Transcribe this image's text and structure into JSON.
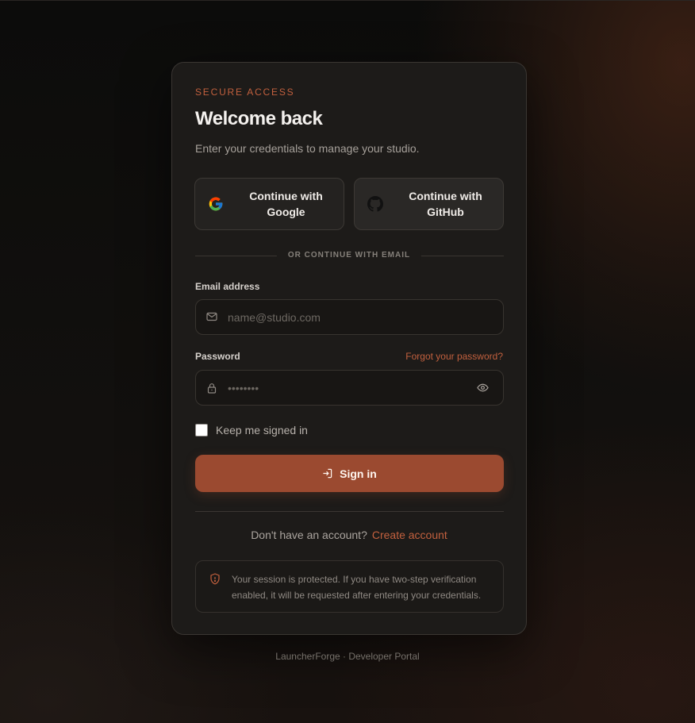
{
  "card": {
    "eyebrow": "SECURE ACCESS",
    "title": "Welcome back",
    "subtitle": "Enter your credentials to manage your studio."
  },
  "oauth": {
    "google_label": "Continue with Google",
    "github_label": "Continue with GitHub"
  },
  "divider_label": "OR CONTINUE WITH EMAIL",
  "email": {
    "label": "Email address",
    "placeholder": "name@studio.com",
    "value": ""
  },
  "password": {
    "label": "Password",
    "forgot_link": "Forgot your password?",
    "placeholder": "••••••••",
    "value": ""
  },
  "remember_label": "Keep me signed in",
  "sign_in_label": "Sign in",
  "signup": {
    "prompt": "Don't have an account?",
    "link": "Create account"
  },
  "notice": "Your session is protected. If you have two-step verification enabled, it will be requested after entering your credentials.",
  "footer": "LauncherForge · Developer Portal",
  "colors": {
    "accent": "#c2603e",
    "button": "#9b4a30",
    "card": "#1d1b19"
  },
  "icons": [
    "google-icon",
    "github-icon",
    "mail-icon",
    "lock-icon",
    "eye-icon",
    "sign-in-icon",
    "shield-icon"
  ]
}
